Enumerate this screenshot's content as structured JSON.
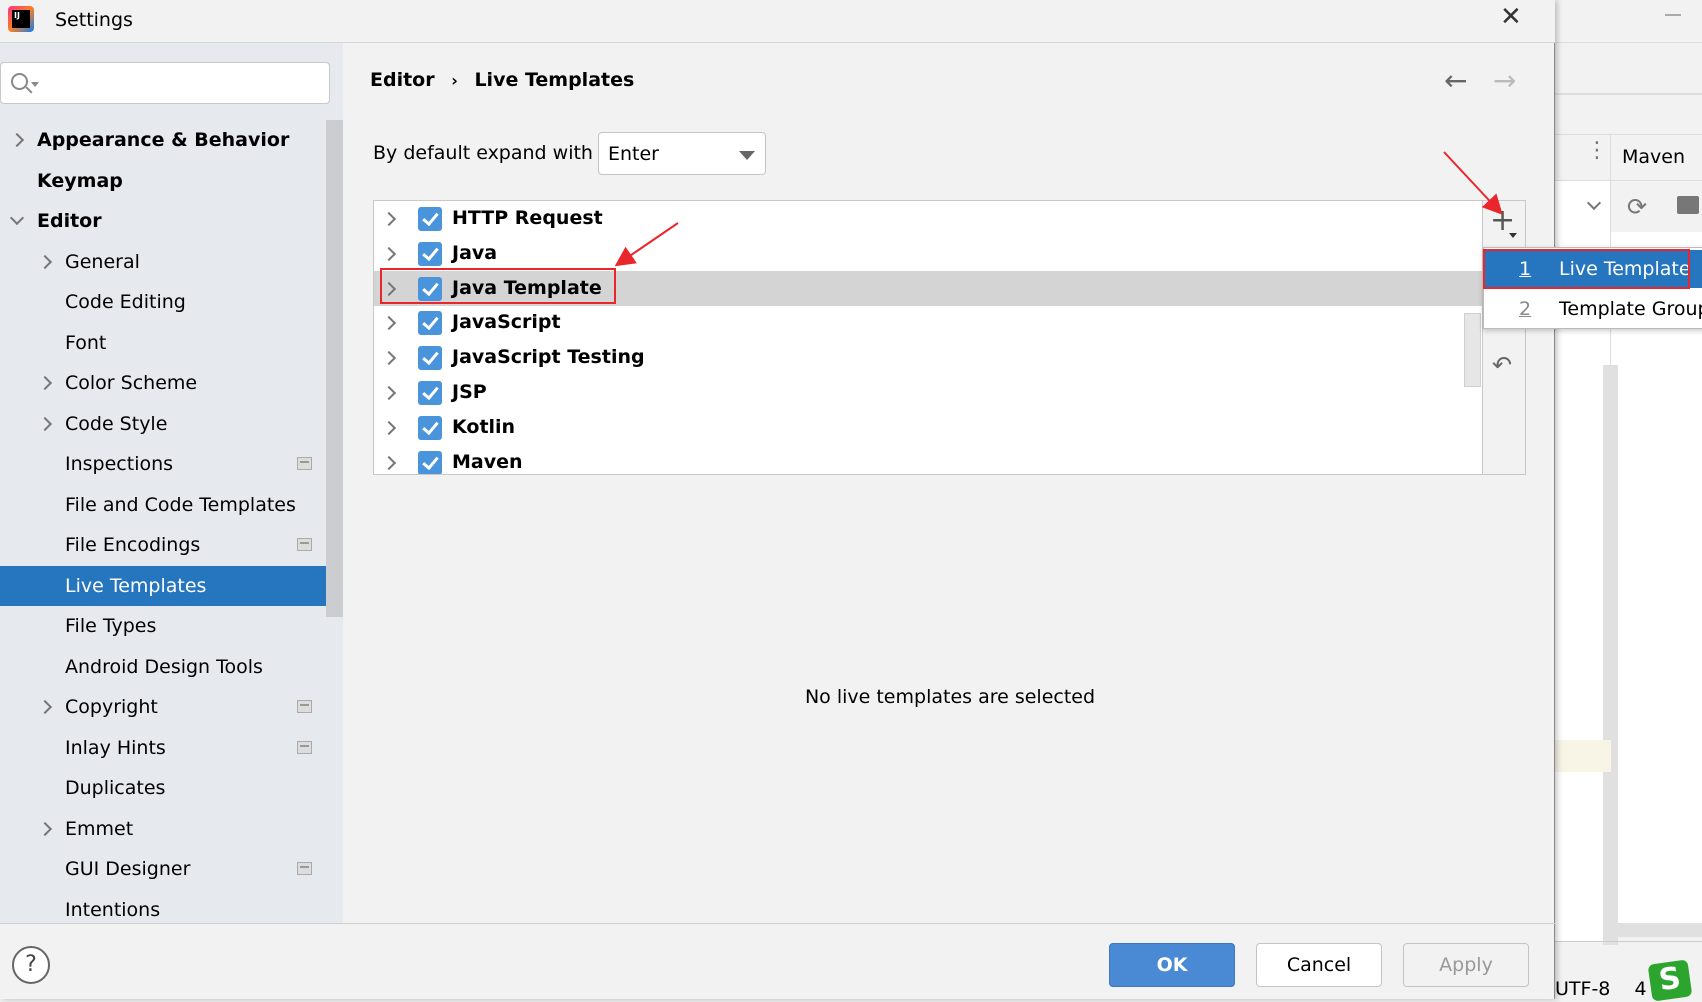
{
  "window": {
    "title": "Settings",
    "close_icon": "close-icon"
  },
  "search": {
    "placeholder": "",
    "value": ""
  },
  "sidebar": {
    "items": [
      {
        "label": "Appearance & Behavior",
        "level": 0,
        "bold": true,
        "expander": "collapsed"
      },
      {
        "label": "Keymap",
        "level": 0,
        "bold": true,
        "expander": "none"
      },
      {
        "label": "Editor",
        "level": 0,
        "bold": true,
        "expander": "expanded"
      },
      {
        "label": "General",
        "level": 1,
        "expander": "collapsed"
      },
      {
        "label": "Code Editing",
        "level": 1,
        "expander": "none"
      },
      {
        "label": "Font",
        "level": 1,
        "expander": "none"
      },
      {
        "label": "Color Scheme",
        "level": 1,
        "expander": "collapsed"
      },
      {
        "label": "Code Style",
        "level": 1,
        "expander": "collapsed"
      },
      {
        "label": "Inspections",
        "level": 1,
        "expander": "none",
        "module_icon": true
      },
      {
        "label": "File and Code Templates",
        "level": 1,
        "expander": "none"
      },
      {
        "label": "File Encodings",
        "level": 1,
        "expander": "none",
        "module_icon": true
      },
      {
        "label": "Live Templates",
        "level": 1,
        "expander": "none",
        "selected": true
      },
      {
        "label": "File Types",
        "level": 1,
        "expander": "none"
      },
      {
        "label": "Android Design Tools",
        "level": 1,
        "expander": "none"
      },
      {
        "label": "Copyright",
        "level": 1,
        "expander": "collapsed",
        "module_icon": true
      },
      {
        "label": "Inlay Hints",
        "level": 1,
        "expander": "none",
        "module_icon": true
      },
      {
        "label": "Duplicates",
        "level": 1,
        "expander": "none"
      },
      {
        "label": "Emmet",
        "level": 1,
        "expander": "collapsed"
      },
      {
        "label": "GUI Designer",
        "level": 1,
        "expander": "none",
        "module_icon": true
      },
      {
        "label": "Intentions",
        "level": 1,
        "expander": "none"
      }
    ]
  },
  "breadcrumb": {
    "parent": "Editor",
    "separator": "›",
    "current": "Live Templates"
  },
  "expand": {
    "label": "By default expand with",
    "value": "Enter"
  },
  "templates": [
    {
      "label": "HTTP Request",
      "checked": true
    },
    {
      "label": "Java",
      "checked": true
    },
    {
      "label": "Java Template",
      "checked": true,
      "selected": true
    },
    {
      "label": "JavaScript",
      "checked": true
    },
    {
      "label": "JavaScript Testing",
      "checked": true
    },
    {
      "label": "JSP",
      "checked": true
    },
    {
      "label": "Kotlin",
      "checked": true
    },
    {
      "label": "Maven",
      "checked": true
    }
  ],
  "add_menu": {
    "items": [
      {
        "mnemonic": "1",
        "label": "Live Template",
        "selected": true
      },
      {
        "mnemonic": "2",
        "label": "Template Group"
      }
    ]
  },
  "empty_message": "No live templates are selected",
  "buttons": {
    "ok": "OK",
    "cancel": "Cancel",
    "apply": "Apply",
    "help": "?"
  },
  "ide": {
    "maven_tab": "Maven",
    "status": "UTF-8    4 s"
  },
  "colors": {
    "accent": "#2675bf",
    "checkbox": "#4a94dc",
    "annotation": "#e8262b"
  }
}
